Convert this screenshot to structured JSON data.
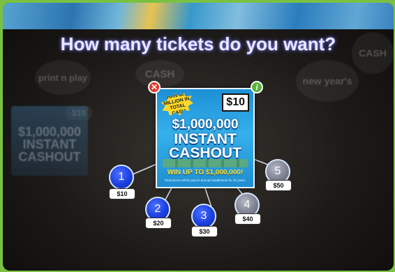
{
  "prompt": "How many tickets do you want?",
  "ticket": {
    "name_line1": "$1,000,000",
    "name_line2": "INSTANT",
    "name_line3": "CASHOUT",
    "price": "$10",
    "burst_text": "MORE THAN $27 MILLION IN TOTAL CASH PRIZES",
    "win_text": "WIN UP TO $1,000,000!",
    "fine_print": "Total prizes will be paid in annual installments for 20 years."
  },
  "options": [
    {
      "qty": "1",
      "price": "$10",
      "state": "available"
    },
    {
      "qty": "2",
      "price": "$20",
      "state": "available"
    },
    {
      "qty": "3",
      "price": "$30",
      "state": "available"
    },
    {
      "qty": "4",
      "price": "$40",
      "state": "disabled"
    },
    {
      "qty": "5",
      "price": "$50",
      "state": "disabled"
    }
  ],
  "background": {
    "blurred_labels": [
      "CASH",
      "print n play",
      "new year's",
      "CASH",
      "$10",
      "$1,000,000 INSTANT CASHOUT"
    ]
  },
  "colors": {
    "accent_blue": "#1b3fe0",
    "disabled_gray": "#7f8392",
    "close_red": "#e03a2c",
    "info_green": "#5ab43a"
  }
}
